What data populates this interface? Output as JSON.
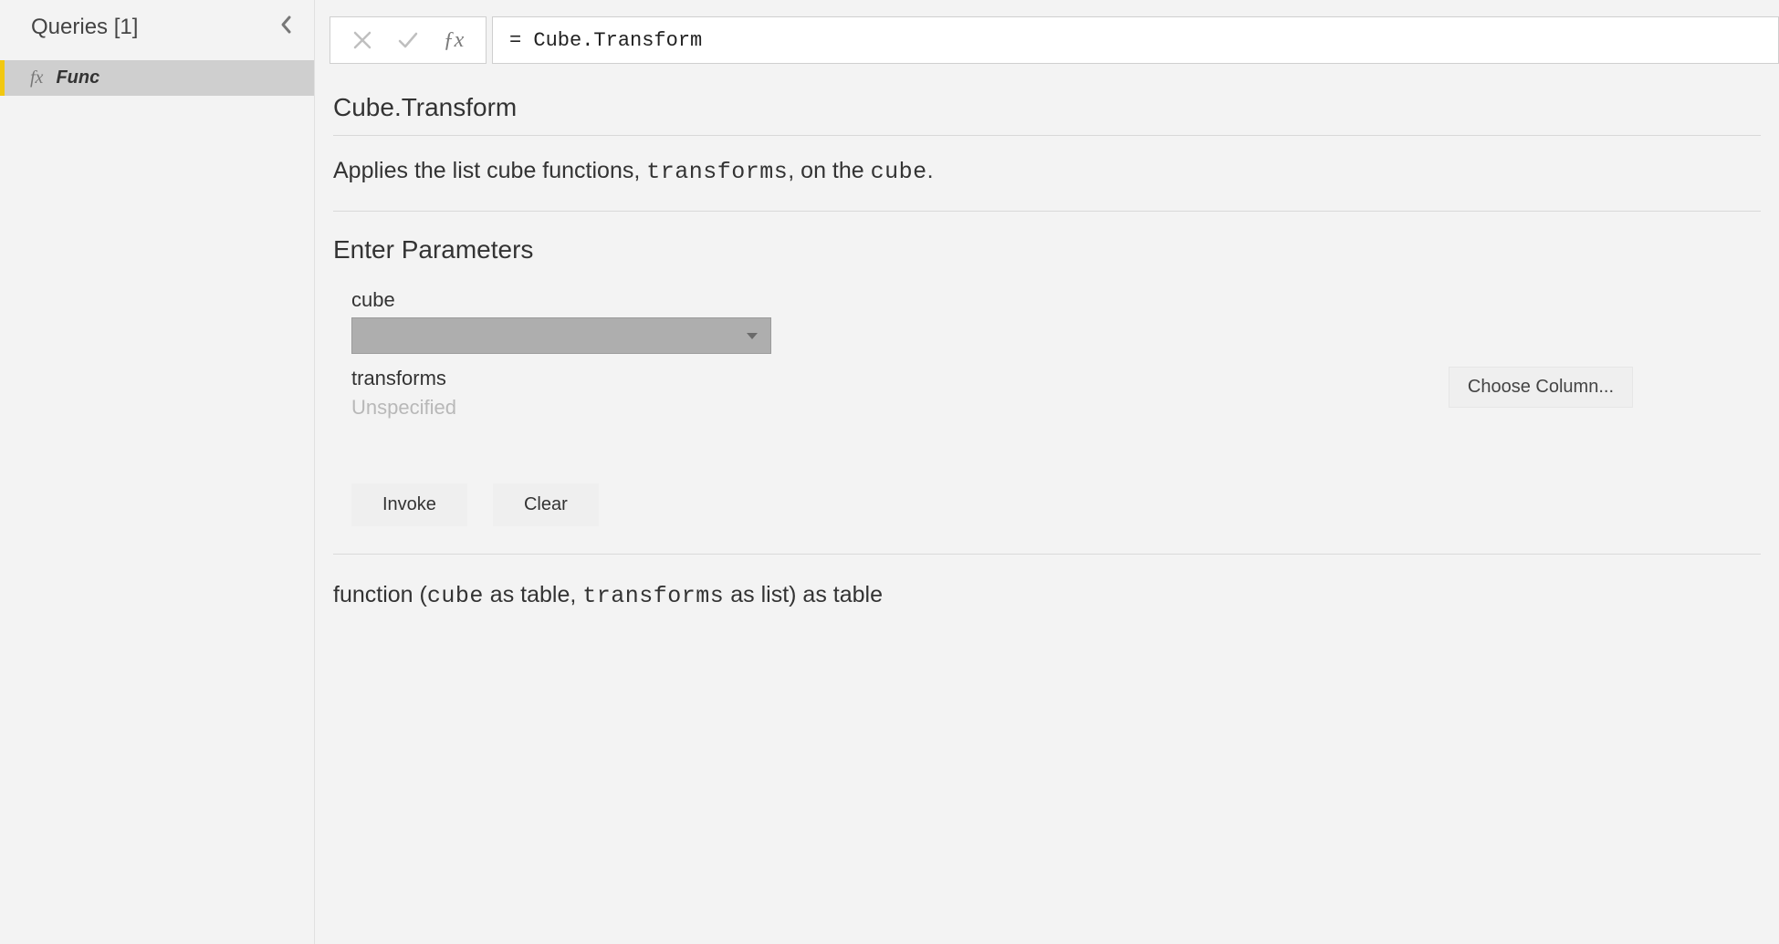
{
  "sidebar": {
    "title": "Queries [1]",
    "items": [
      {
        "icon": "fx",
        "label": "Func"
      }
    ]
  },
  "formulaBar": {
    "value": "= Cube.Transform"
  },
  "function": {
    "name": "Cube.Transform",
    "description_prefix": "Applies the list cube functions, ",
    "description_param1": "transforms",
    "description_mid": ", on the ",
    "description_param2": "cube",
    "description_suffix": "."
  },
  "parameters": {
    "heading": "Enter Parameters",
    "items": [
      {
        "label": "cube",
        "input_type": "dropdown",
        "value": ""
      },
      {
        "label": "transforms",
        "input_type": "column",
        "value": "Unspecified",
        "action": "Choose Column..."
      }
    ]
  },
  "buttons": {
    "invoke": "Invoke",
    "clear": "Clear"
  },
  "signature": {
    "prefix": "function (",
    "p1": "cube",
    "p1t": " as table, ",
    "p2": "transforms",
    "p2t": " as list) as table"
  }
}
